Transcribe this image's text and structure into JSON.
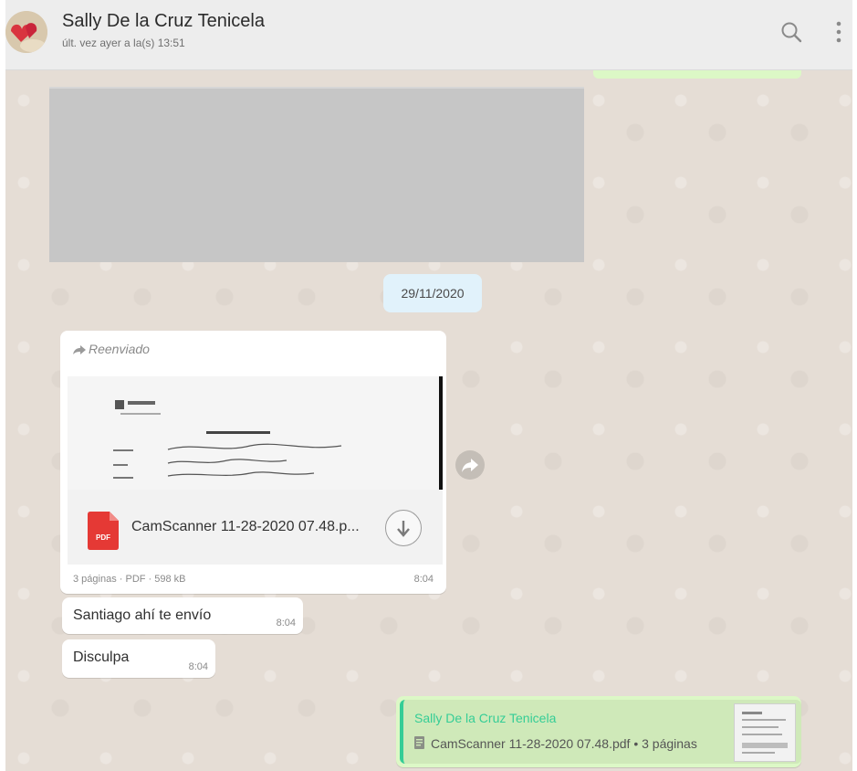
{
  "header": {
    "contact_name": "Sally De la Cruz Tenicela",
    "last_seen": "últ. vez ayer a la(s) 13:51"
  },
  "date_divider": "29/11/2020",
  "document_message": {
    "forwarded_label": "Reenviado",
    "file_name": "CamScanner 11-28-2020 07.48.p...",
    "meta": "3 páginas · PDF · 598 kB",
    "time": "8:04"
  },
  "messages": [
    {
      "text": "Santiago ahí te envío",
      "time": "8:04"
    },
    {
      "text": "Disculpa",
      "time": "8:04"
    }
  ],
  "reply_quote": {
    "author": "Sally De la Cruz Tenicela",
    "text": "CamScanner 11-28-2020 07.48.pdf • 3 páginas"
  },
  "icons": [
    "avatar",
    "search-icon",
    "menu-icon",
    "forward-icon",
    "pdf-icon",
    "download-icon",
    "share-icon",
    "document-icon"
  ],
  "colors": {
    "chat_bg": "#e5ddd5",
    "outgoing": "#dcf8c6",
    "accent": "#35cd96",
    "date_chip": "#e1f2fb"
  }
}
